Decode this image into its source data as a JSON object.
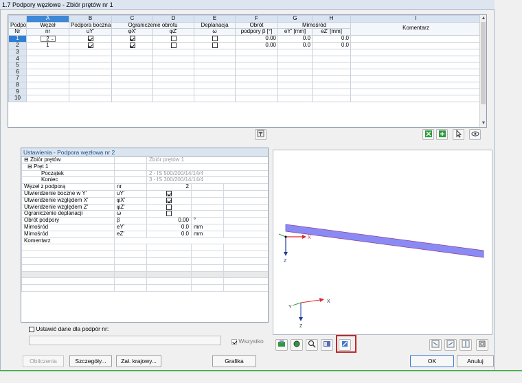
{
  "window": {
    "title": "1.7 Podpory węzłowe - Zbiór prętów nr 1"
  },
  "grid": {
    "letters": [
      "A",
      "B",
      "C",
      "D",
      "E",
      "F",
      "G",
      "H",
      "I"
    ],
    "head1": {
      "podpora": "Podpora",
      "wezel": "Węzeł",
      "boczna": "Podpora boczna",
      "ogr": "Ograniczenie obrotu",
      "depl": "Deplanacja",
      "obrot": "Obrót",
      "mim": "Mimośród",
      "kom": "Komentarz"
    },
    "head2": {
      "nr": "Nr",
      "wezel_nr": "nr",
      "uy": "uY'",
      "phix": "φX'",
      "phiz": "φZ'",
      "omega": "ω",
      "beta": "podpory β [°]",
      "ey": "eY' [mm]",
      "ez": "eZ' [mm]"
    },
    "rows": [
      {
        "nr": "1",
        "node": "2",
        "uy": true,
        "phix": true,
        "phiz": false,
        "depl": false,
        "beta": "0.00",
        "ey": "0.0",
        "ez": "0.0"
      },
      {
        "nr": "2",
        "node": "1",
        "uy": true,
        "phix": true,
        "phiz": false,
        "depl": false,
        "beta": "0.00",
        "ey": "0.0",
        "ez": "0.0"
      }
    ],
    "empty_rows": [
      "3",
      "4",
      "5",
      "6",
      "7",
      "8",
      "9",
      "10"
    ]
  },
  "settings": {
    "header": "Ustawienia - Podpora węzłowa nr 2",
    "zbior": {
      "label": "Zbiór prętów",
      "value": "Zbiór prętów 1"
    },
    "pret": "Pręt 1",
    "poczatek": {
      "label": "Początek",
      "value": "2 - IS 500/200/14/14/4"
    },
    "koniec": {
      "label": "Koniec",
      "value": "3 - IS 300/200/14/14/4"
    },
    "wezel": {
      "label": "Węzeł z podporą",
      "sym": "nr",
      "value": "2"
    },
    "uy": {
      "label": "Utwierdzenie boczne w Y'",
      "sym": "uY'",
      "checked": true
    },
    "phix": {
      "label": "Utwierdzenie względem X'",
      "sym": "φX'",
      "checked": true
    },
    "phiz": {
      "label": "Utwierdzenie względem Z'",
      "sym": "φZ'",
      "checked": false
    },
    "depl": {
      "label": "Ograniczenie deplanacji",
      "sym": "ω",
      "checked": false
    },
    "obrot": {
      "label": "Obrót podpory",
      "sym": "β",
      "value": "0.00",
      "unit": "°"
    },
    "mimy": {
      "label": "Mimośród",
      "sym": "eY'",
      "value": "0.0",
      "unit": "mm"
    },
    "mimz": {
      "label": "Mimośród",
      "sym": "eZ'",
      "value": "0.0",
      "unit": "mm"
    },
    "komentarz": {
      "label": "Komentarz"
    }
  },
  "options": {
    "ustawic": "Ustawić dane dla podpór nr:",
    "wszystko": "Wszystko"
  },
  "view": {
    "axis_x": "X",
    "axis_z": "Z",
    "axis_y": "Y"
  },
  "buttons": {
    "obliczenia": "Obliczenia",
    "szczegoly": "Szczegóły...",
    "zal": "Zał. krajowy...",
    "grafika": "Grafika",
    "ok": "OK",
    "anuluj": "Anuluj"
  },
  "colors": {
    "beam": "#8a8af5",
    "accent": "#2f7fd3",
    "highlight": "#c0272d"
  }
}
